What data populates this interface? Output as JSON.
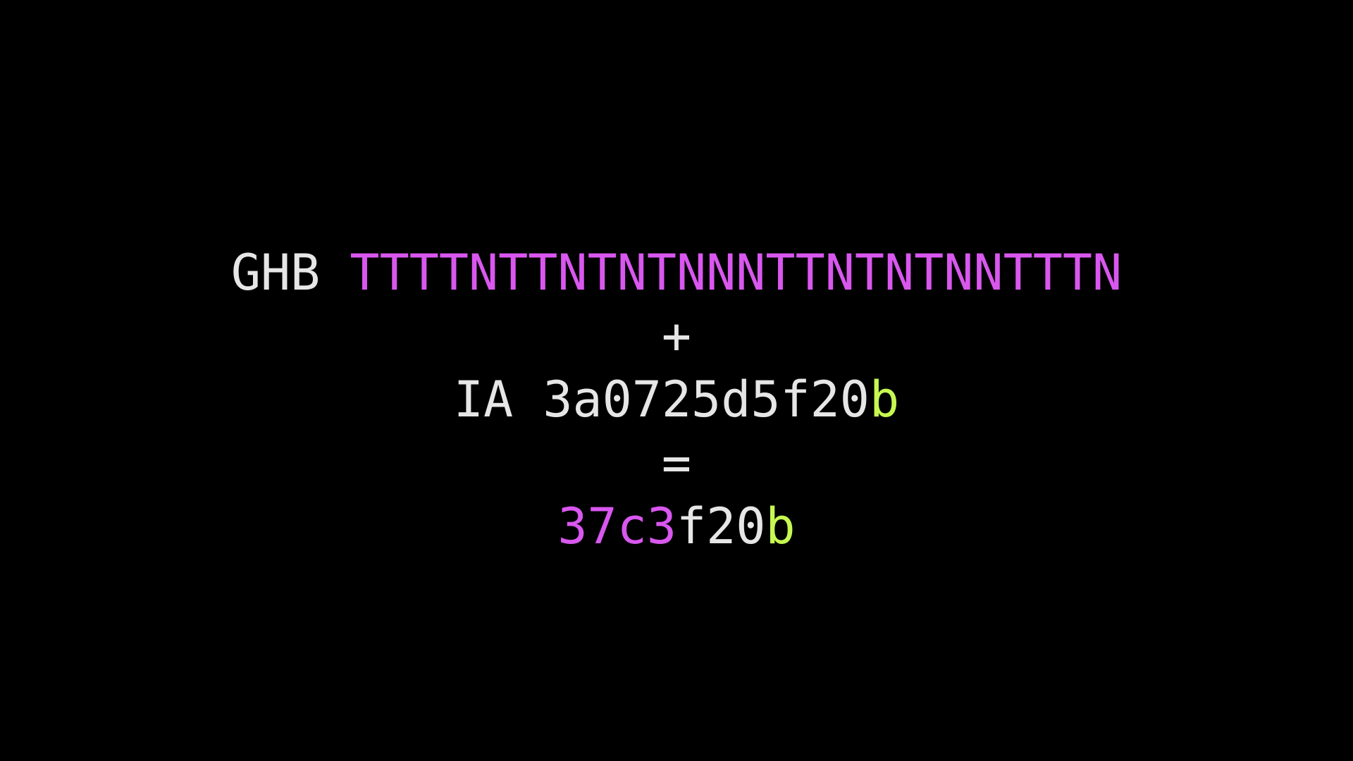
{
  "line1": {
    "prefix": "GHB ",
    "code": "TTTTNTTNTNTNNNTTNTNTNNTTTN"
  },
  "operator_plus": "+",
  "line3": {
    "prefix": "IA ",
    "hash_plain": "3a0725d5f20",
    "hash_highlight": "b"
  },
  "operator_equals": "=",
  "line5": {
    "result_magenta": "37c3",
    "result_plain": "f20",
    "result_highlight": "b"
  },
  "colors": {
    "background": "#000000",
    "text": "#e6e6e6",
    "magenta": "#d957ef",
    "green": "#c6f84f"
  }
}
